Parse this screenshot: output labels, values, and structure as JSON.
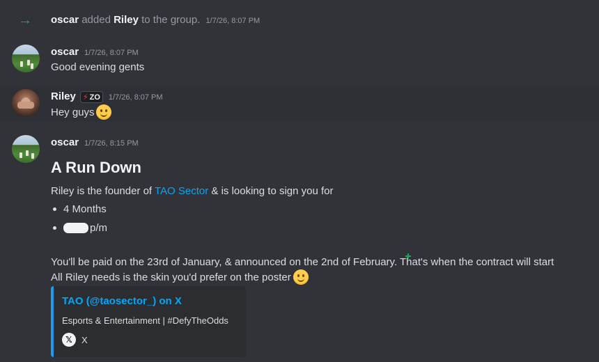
{
  "system_message": {
    "actor": "oscar",
    "action": "added",
    "target": "Riley",
    "suffix": "to the group.",
    "timestamp": "1/7/26, 8:07 PM"
  },
  "messages": [
    {
      "author": "oscar",
      "timestamp": "1/7/26, 8:07 PM",
      "text": "Good evening gents"
    },
    {
      "author": "Riley",
      "tag": "ZO",
      "timestamp": "1/7/26, 8:07 PM",
      "text": "Hey guys"
    },
    {
      "author": "oscar",
      "timestamp": "1/7/26, 8:15 PM",
      "heading": "A Run Down",
      "line1_before": "Riley is the founder of ",
      "line1_link": "TAO Sector",
      "line1_after": " & is looking to sign you for",
      "bullets": [
        "4 Months",
        "p/m"
      ],
      "line2": "You'll be paid on the 23rd of January, & announced on the 2nd of February. That's when the contract will start",
      "line3": "All Riley needs is the skin you'd prefer on the poster"
    }
  ],
  "embed": {
    "title": "TAO (@taosector_) on X",
    "description": "Esports & Entertainment | #DefyTheOdds",
    "footer": "X",
    "accent_color": "#1d9bf0"
  },
  "colors": {
    "background": "#313338",
    "link": "#00a8fc",
    "join_arrow": "#23a55a"
  }
}
